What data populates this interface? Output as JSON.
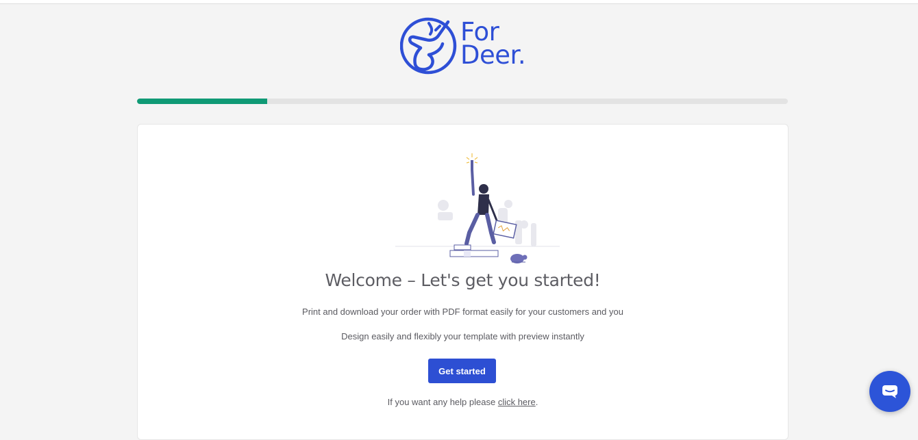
{
  "brand": {
    "logo_line1": "For",
    "logo_line2": "Deer.",
    "color": "#2e4fd6"
  },
  "progress": {
    "fraction": 0.2,
    "color": "#0f9a75"
  },
  "welcome": {
    "heading": "Welcome – Let's get you started!",
    "line1": "Print and download your order with PDF format easily for your customers and you",
    "line2": "Design easily and flexibly your template with preview instantly",
    "button_label": "Get started",
    "help_prefix": "If you want any help please ",
    "help_link": "click here",
    "help_suffix": "."
  },
  "chat": {
    "icon": "chat-bubble-icon",
    "color": "#2c54d8"
  }
}
